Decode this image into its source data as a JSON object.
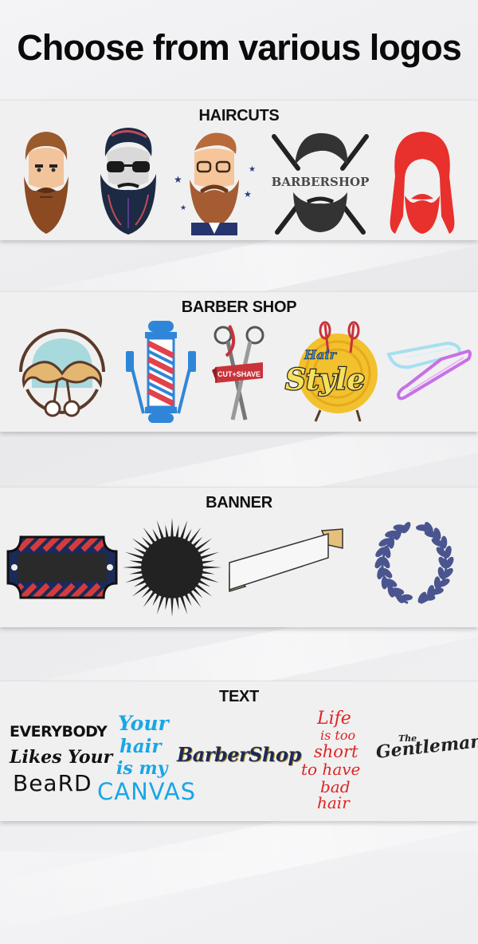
{
  "page": {
    "headline": "Choose from various logos"
  },
  "sections": [
    {
      "title": "HAIRCUTS",
      "items": [
        {
          "icon": "bearded-man-face-icon"
        },
        {
          "icon": "bearded-skull-glasses-icon"
        },
        {
          "icon": "hipster-beard-glasses-icon"
        },
        {
          "icon": "barbershop-beard-razors-icon",
          "text": "BARBERSHOP"
        },
        {
          "icon": "red-hair-beard-silhouette-icon"
        }
      ]
    },
    {
      "title": "BARBER SHOP",
      "items": [
        {
          "icon": "mustache-scissors-emblem-icon"
        },
        {
          "icon": "barber-pole-icon"
        },
        {
          "icon": "scissors-ribbon-icon",
          "text": "CUT+SHAVE"
        },
        {
          "icon": "hair-style-badge-icon",
          "text_small": "Hair",
          "text_big": "Style"
        },
        {
          "icon": "neon-straight-razor-icon"
        }
      ]
    },
    {
      "title": "BANNER",
      "items": [
        {
          "icon": "striped-banner-plate-icon"
        },
        {
          "icon": "starburst-icon"
        },
        {
          "icon": "ribbon-banner-icon"
        },
        {
          "icon": "laurel-wreath-icon"
        }
      ]
    },
    {
      "title": "TEXT",
      "items": [
        {
          "icon": "everybody-likes-beard-text-icon",
          "lines": [
            "EVERYBODY",
            "Likes Your",
            "BeaRD"
          ]
        },
        {
          "icon": "your-hair-canvas-text-icon",
          "lines": [
            "Your",
            "hair",
            "is my",
            "CANVAS"
          ]
        },
        {
          "icon": "barbershop-script-text-icon",
          "text": "BarberShop"
        },
        {
          "icon": "life-too-short-text-icon",
          "lines": [
            "Life",
            "is too",
            "short",
            "to have",
            "bad",
            "hair"
          ]
        },
        {
          "icon": "the-gentleman-text-icon",
          "small": "The",
          "big": "Gentleman"
        }
      ]
    }
  ],
  "colors": {
    "pole_red": "#e0434c",
    "pole_blue": "#2f86d8",
    "neon_pink": "#c770e8",
    "script_red": "#e02424",
    "script_cyan": "#1aa6e6",
    "badge_yellow": "#f2c12e"
  }
}
